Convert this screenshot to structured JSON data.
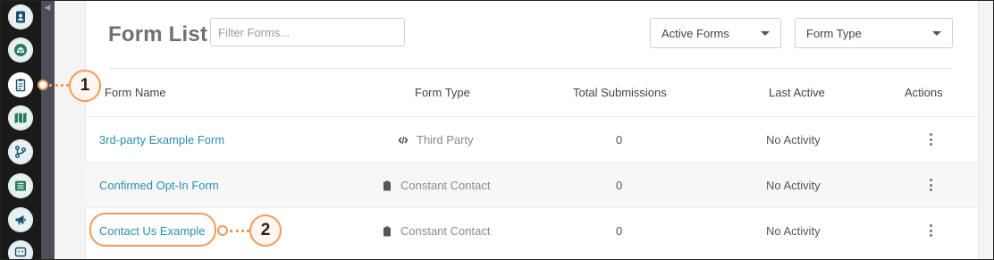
{
  "header": {
    "title": "Form List",
    "filter_placeholder": "Filter Forms...",
    "status_select": "Active Forms",
    "type_select": "Form Type"
  },
  "table": {
    "columns": [
      "Form Name",
      "Form Type",
      "Total Submissions",
      "Last Active",
      "Actions"
    ],
    "rows": [
      {
        "name": "3rd-party Example Form",
        "type": "Third Party",
        "type_icon": "code-icon",
        "submissions": "0",
        "last_active": "No Activity"
      },
      {
        "name": "Confirmed Opt-In Form",
        "type": "Constant Contact",
        "type_icon": "clipboard-icon",
        "submissions": "0",
        "last_active": "No Activity"
      },
      {
        "name": "Contact Us Example",
        "type": "Constant Contact",
        "type_icon": "clipboard-icon",
        "submissions": "0",
        "last_active": "No Activity"
      }
    ]
  },
  "sidebar": {
    "icons": [
      "contacts-icon",
      "inbox-icon",
      "clipboard-icon",
      "map-icon",
      "workflow-icon",
      "list-icon",
      "megaphone-icon",
      "feedback-icon"
    ]
  },
  "callouts": [
    {
      "label": "1",
      "target": "sidebar forms icon"
    },
    {
      "label": "2",
      "target": "Contact Us Example link"
    }
  ],
  "colors": {
    "accent": "#f39a5a",
    "link": "#2b8fb1",
    "rail": "#1a1a1a"
  }
}
